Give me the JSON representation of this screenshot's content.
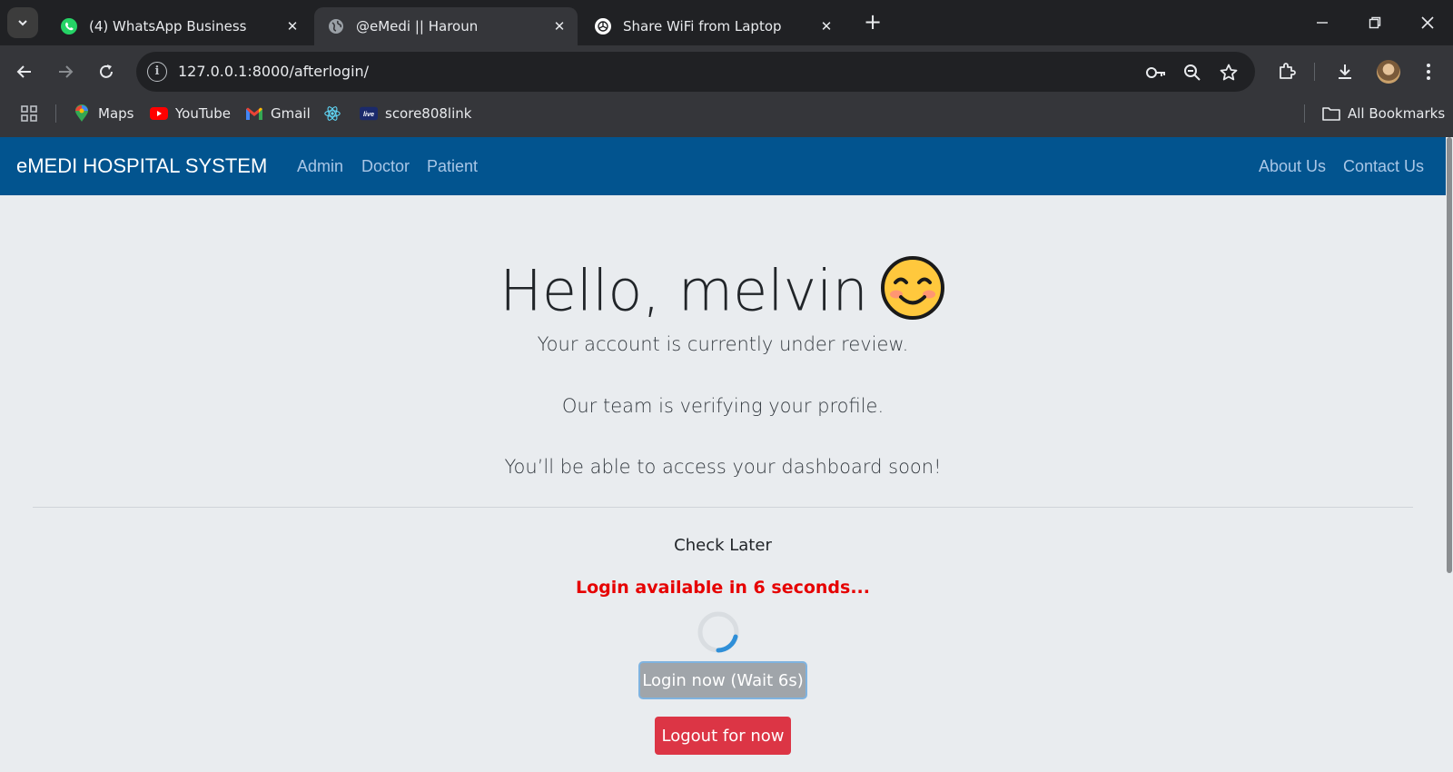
{
  "browser": {
    "tabs": [
      {
        "title": "(4) WhatsApp Business",
        "icon": "whatsapp-icon"
      },
      {
        "title": "@eMedi || Haroun",
        "icon": "globe-icon",
        "active": true
      },
      {
        "title": "Share WiFi from Laptop",
        "icon": "chatgpt-icon"
      }
    ],
    "url": "127.0.0.1:8000/afterlogin/",
    "bookmarks": [
      {
        "label": "Maps",
        "icon": "maps-icon"
      },
      {
        "label": "YouTube",
        "icon": "youtube-icon"
      },
      {
        "label": "Gmail",
        "icon": "gmail-icon"
      },
      {
        "label": "",
        "icon": "react-icon"
      },
      {
        "label": "score808link",
        "icon": "live-icon"
      }
    ],
    "all_bookmarks": "All Bookmarks"
  },
  "app": {
    "brand": "eMEDI HOSPITAL SYSTEM",
    "nav_left": [
      "Admin",
      "Doctor",
      "Patient"
    ],
    "nav_right": [
      "About Us",
      "Contact Us"
    ],
    "colors": {
      "navbar": "#02548f",
      "danger": "#dc3545",
      "countdown": "#e60000"
    }
  },
  "main": {
    "greeting": "Hello, melvin",
    "emoji": "smiling-face-icon",
    "messages": [
      "Your account is currently under review.",
      "Our team is verifying your profile.",
      "You’ll be able to access your dashboard soon!"
    ],
    "check_later": "Check Later",
    "countdown_text": "Login available in 6 seconds...",
    "login_button": "Login now (Wait 6s)",
    "logout_button": "Logout for now"
  }
}
